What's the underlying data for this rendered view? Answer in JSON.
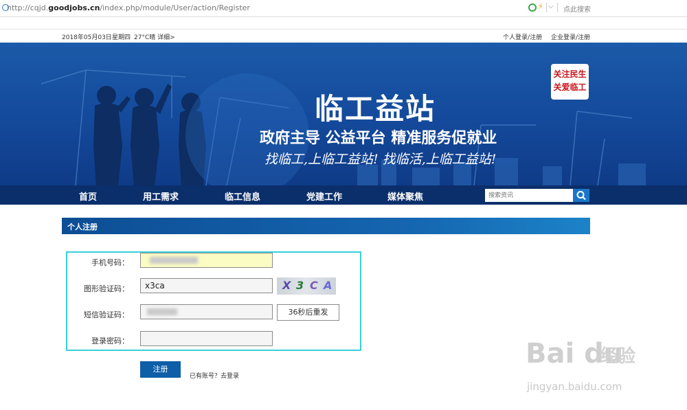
{
  "browser": {
    "url_prefix": "http://cqjd.",
    "url_domain": "goodjobs.cn",
    "url_path": "/index.php/module/User/action/Register",
    "search_hint": "点此搜索"
  },
  "topbar": {
    "date": "2018年05月03日",
    "weekday": "星期四",
    "weather": "27°C晴 详细>",
    "personal_login": "个人登录/注册",
    "company_login": "企业登录/注册"
  },
  "banner": {
    "seal_line1": "关注民生",
    "seal_line2": "关爱临工",
    "title": "临工益站",
    "subtitle": "政府主导 公益平台 精准服务促就业",
    "slogan": "找临工,上临工益站! 找临活,上临工益站!"
  },
  "nav": {
    "items": [
      "首页",
      "用工需求",
      "临工信息",
      "党建工作",
      "媒体聚焦"
    ],
    "search_placeholder": "搜索资讯"
  },
  "section": {
    "title": "个人注册"
  },
  "form": {
    "phone_label": "手机号码：",
    "captcha_label": "图形验证码：",
    "captcha_value": "x3ca",
    "captcha_image_chars": [
      "X",
      "3",
      "C",
      "A"
    ],
    "sms_label": "短信验证码：",
    "resend_label": "36秒后重发",
    "password_label": "登录密码：",
    "submit_label": "注册",
    "login_link": "已有账号？去登录"
  },
  "watermark": {
    "brand": "Bai du",
    "brand_cn": "经验",
    "url": "jingyan.baidu.com"
  },
  "colors": {
    "nav_bg": "#0b2f6b",
    "highlight_border": "#38cfd8",
    "phone_field_bg": "#fbfbc4",
    "submit_bg": "#0e5ea8"
  }
}
